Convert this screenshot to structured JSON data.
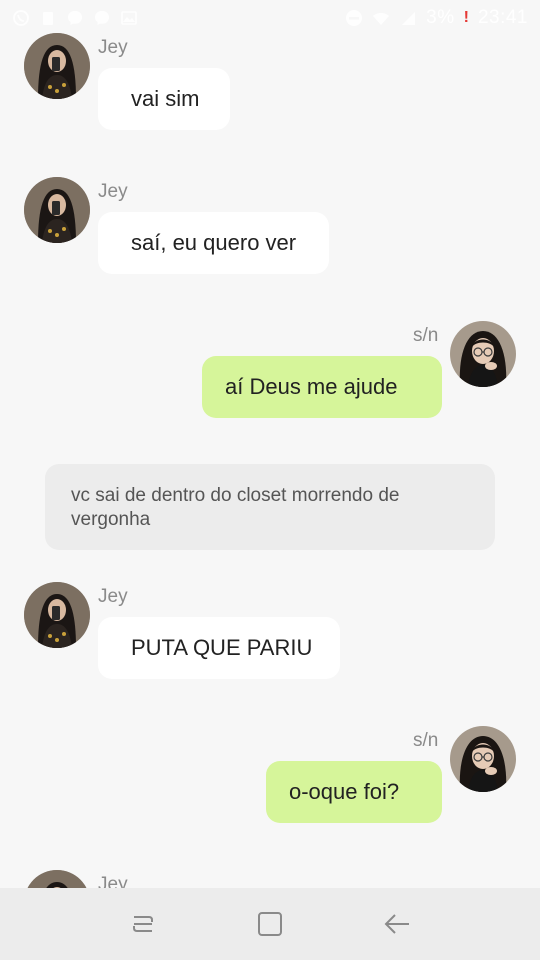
{
  "status_bar": {
    "icons_left": [
      "whatsapp-icon",
      "clipboard-icon",
      "messenger-icon",
      "messenger-icon",
      "gallery-icon"
    ],
    "icons_right": [
      "do-not-disturb-icon",
      "wifi-icon",
      "signal-icon"
    ],
    "battery": "3%",
    "time": "23:41"
  },
  "messages": [
    {
      "sender": "Jey",
      "text": "vai sim"
    },
    {
      "sender": "Jey",
      "text": "saí, eu quero ver"
    },
    {
      "sender": "s/n",
      "text": "aí Deus me ajude"
    },
    {
      "narration": "vc sai de dentro do closet morrendo de vergonha"
    },
    {
      "sender": "Jey",
      "text": "PUTA QUE PARIU"
    },
    {
      "sender": "s/n",
      "text": "o-oque foi?"
    },
    {
      "sender": "Jey"
    }
  ],
  "nav": [
    "recent-apps-icon",
    "home-icon",
    "back-icon"
  ],
  "colors": {
    "background": "#f7f7f7",
    "incoming_bubble": "#ffffff",
    "outgoing_bubble": "#d6f59a",
    "narration_bubble": "#ececec",
    "nav_bar": "#ececec"
  }
}
